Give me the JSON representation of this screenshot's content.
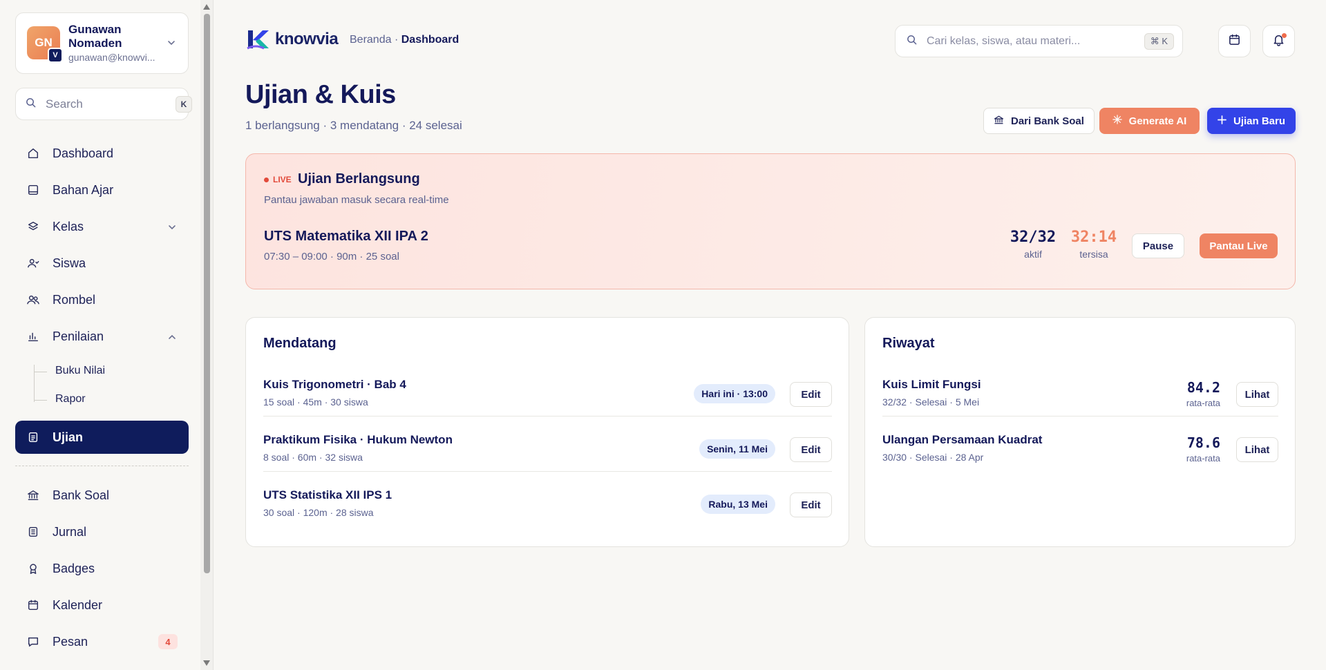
{
  "sidebar": {
    "user": {
      "initials": "GN",
      "badge": "V",
      "name": "Gunawan Nomaden",
      "email": "gunawan@knowvi..."
    },
    "search": {
      "placeholder": "Search",
      "shortcut": "K"
    },
    "items": [
      {
        "label": "Dashboard",
        "icon": "home-icon"
      },
      {
        "label": "Bahan Ajar",
        "icon": "book-icon"
      },
      {
        "label": "Kelas",
        "icon": "layers-icon"
      },
      {
        "label": "Siswa",
        "icon": "users-icon"
      },
      {
        "label": "Rombel",
        "icon": "group-icon"
      },
      {
        "label": "Penilaian",
        "icon": "chart-icon"
      },
      {
        "label": "Ujian",
        "icon": "document-icon"
      },
      {
        "label": "Bank Soal",
        "icon": "bank-icon"
      },
      {
        "label": "Jurnal",
        "icon": "journal-icon"
      },
      {
        "label": "Badges",
        "icon": "award-icon"
      },
      {
        "label": "Kalender",
        "icon": "calendar-icon"
      },
      {
        "label": "Pesan",
        "icon": "message-icon",
        "badge": "4"
      }
    ],
    "sub_items": [
      "Buku Nilai",
      "Rapor"
    ]
  },
  "header": {
    "logo_text": "knowvia",
    "breadcrumb_root": "Beranda",
    "breadcrumb_sep": "·",
    "breadcrumb_current": "Dashboard",
    "search_placeholder": "Cari kelas, siswa, atau materi...",
    "search_shortcut": "⌘ K"
  },
  "page": {
    "title": "Ujian & Kuis",
    "subtitle": "1 berlangsung · 3 mendatang · 24 selesai",
    "actions": {
      "bank": "Dari Bank Soal",
      "ai": "Generate AI",
      "new": "Ujian Baru"
    }
  },
  "live": {
    "tag": "LIVE",
    "title": "Ujian Berlangsung",
    "desc": "Pantau jawaban masuk secara real-time",
    "exam_name": "UTS Matematika XII IPA 2",
    "exam_meta": "07:30 – 09:00 · 90m · 25 soal",
    "active_value": "32/32",
    "active_label": "aktif",
    "remaining_value": "32:14",
    "remaining_label": "tersisa",
    "pause_label": "Pause",
    "monitor_label": "Pantau Live"
  },
  "upcoming": {
    "title": "Mendatang",
    "edit_label": "Edit",
    "rows": [
      {
        "title": "Kuis Trigonometri · Bab 4",
        "meta": "15 soal · 45m · 30 siswa",
        "when": "Hari ini · 13:00"
      },
      {
        "title": "Praktikum Fisika · Hukum Newton",
        "meta": "8 soal · 60m · 32 siswa",
        "when": "Senin, 11 Mei"
      },
      {
        "title": "UTS Statistika XII IPS 1",
        "meta": "30 soal · 120m · 28 siswa",
        "when": "Rabu, 13 Mei"
      }
    ]
  },
  "history": {
    "title": "Riwayat",
    "view_label": "Lihat",
    "avg_label": "rata-rata",
    "rows": [
      {
        "title": "Kuis Limit Fungsi",
        "meta": "32/32 · Selesai · 5 Mei",
        "score": "84.2"
      },
      {
        "title": "Ulangan Persamaan Kuadrat",
        "meta": "30/30 · Selesai · 28 Apr",
        "score": "78.6"
      }
    ]
  },
  "colors": {
    "primary": "#3343e8",
    "accent": "#ef8463",
    "navy": "#0f1c5c",
    "live_red": "#e24a3b"
  }
}
